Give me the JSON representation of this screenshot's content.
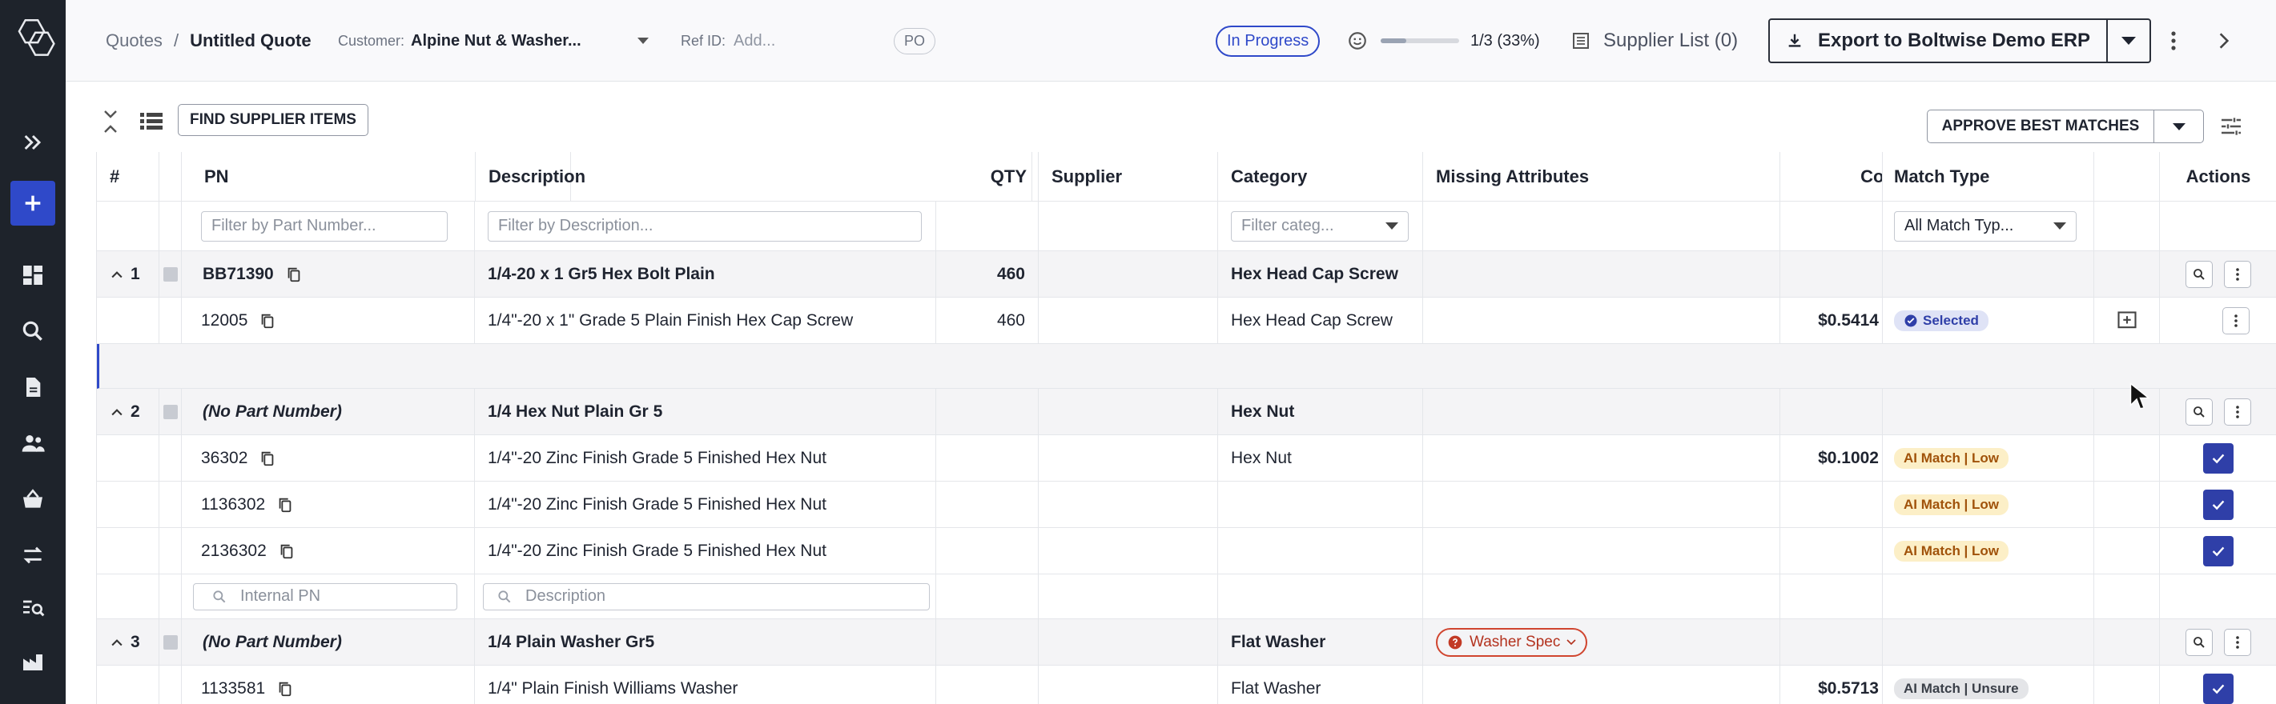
{
  "header": {
    "breadcrumb_root": "Quotes",
    "breadcrumb_sep": "/",
    "quote_title": "Untitled Quote",
    "customer_label": "Customer:",
    "customer_value": "Alpine Nut & Washer...",
    "ref_label": "Ref ID:",
    "ref_placeholder": "Add...",
    "po_badge": "PO",
    "status": "In Progress",
    "progress_text": "1/3 (33%)",
    "progress_fraction": 0.33,
    "supplier_list": "Supplier List (0)",
    "export_label": "Export to Boltwise Demo ERP"
  },
  "toolbar": {
    "find_label": "FIND SUPPLIER ITEMS",
    "approve_label": "APPROVE BEST MATCHES"
  },
  "columns": {
    "num": "#",
    "pn": "PN",
    "description": "Description",
    "qty": "QTY",
    "supplier": "Supplier",
    "category": "Category",
    "missing": "Missing Attributes",
    "cost": "Cost",
    "match": "Match Type",
    "actions": "Actions"
  },
  "filters": {
    "pn": "Filter by Part Number...",
    "description": "Filter by Description...",
    "category": "Filter categ...",
    "match": "All Match Typ..."
  },
  "search_row": {
    "pn_placeholder": "Internal PN",
    "desc_placeholder": "Description"
  },
  "groups": [
    {
      "num": "1",
      "pn": "BB71390",
      "description": "1/4-20 x 1 Gr5 Hex Bolt Plain",
      "qty": "460",
      "category": "Hex Head Cap Screw",
      "children": [
        {
          "pn": "12005",
          "description": "1/4\"-20 x 1\" Grade 5 Plain Finish Hex Cap Screw",
          "qty": "460",
          "category": "Hex Head Cap Screw",
          "cost": "$0.5414",
          "match": "Selected"
        }
      ]
    },
    {
      "num": "2",
      "pn": "(No Part Number)",
      "description": "1/4 Hex Nut Plain Gr 5",
      "qty": "",
      "category": "Hex Nut",
      "children": [
        {
          "pn": "36302",
          "description": "1/4\"-20 Zinc Finish Grade 5 Finished Hex Nut",
          "category": "Hex Nut",
          "cost": "$0.1002",
          "match": "AI Match | Low"
        },
        {
          "pn": "1136302",
          "description": "1/4\"-20 Zinc Finish Grade 5 Finished Hex Nut",
          "category": "",
          "cost": "",
          "match": "AI Match | Low"
        },
        {
          "pn": "2136302",
          "description": "1/4\"-20 Zinc Finish Grade 5 Finished Hex Nut",
          "category": "",
          "cost": "",
          "match": "AI Match | Low"
        }
      ]
    },
    {
      "num": "3",
      "pn": "(No Part Number)",
      "description": "1/4 Plain Washer Gr5",
      "category": "Flat Washer",
      "missing": "Washer Spec",
      "children": [
        {
          "pn": "1133581",
          "description": "1/4\" Plain Finish Williams Washer",
          "category": "Flat Washer",
          "cost": "$0.5713",
          "match": "AI Match | Unsure"
        }
      ]
    }
  ]
}
